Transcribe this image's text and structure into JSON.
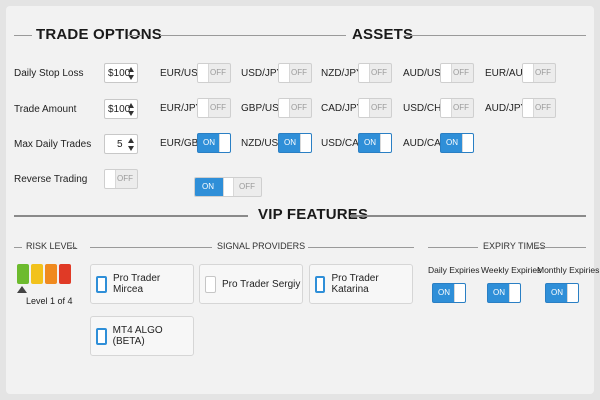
{
  "trade_options": {
    "title": "TRADE OPTIONS",
    "daily_stop_loss": {
      "label": "Daily Stop Loss",
      "value": "$100"
    },
    "trade_amount": {
      "label": "Trade Amount",
      "value": "$100"
    },
    "max_daily_trades": {
      "label": "Max Daily Trades",
      "value": "5"
    },
    "reverse_trading": {
      "label": "Reverse Trading",
      "state": "OFF"
    }
  },
  "assets": {
    "title": "ASSETS",
    "pairs": [
      {
        "label": "EUR/USD",
        "state": "OFF"
      },
      {
        "label": "USD/JPY",
        "state": "OFF"
      },
      {
        "label": "NZD/JPY",
        "state": "OFF"
      },
      {
        "label": "AUD/USD",
        "state": "OFF"
      },
      {
        "label": "EUR/AUD",
        "state": "OFF"
      },
      {
        "label": "EUR/JPY",
        "state": "OFF"
      },
      {
        "label": "GBP/USD",
        "state": "OFF"
      },
      {
        "label": "CAD/JPY",
        "state": "OFF"
      },
      {
        "label": "USD/CHF",
        "state": "OFF"
      },
      {
        "label": "AUD/JPY",
        "state": "OFF"
      },
      {
        "label": "EUR/GBP",
        "state": "ON"
      },
      {
        "label": "NZD/USD",
        "state": "ON"
      },
      {
        "label": "USD/CAD",
        "state": "ON"
      },
      {
        "label": "AUD/CAD",
        "state": "ON"
      }
    ],
    "master_toggle": {
      "on_label": "ON",
      "off_label": "OFF"
    }
  },
  "vip": {
    "title": "VIP FEATURES",
    "risk_level": {
      "title": "RISK LEVEL",
      "text": "Level 1 of 4",
      "colors": [
        "#6dbb2e",
        "#f2c21c",
        "#f08a1f",
        "#e03a26"
      ]
    },
    "signal_providers": {
      "title": "SIGNAL PROVIDERS",
      "items": [
        {
          "label": "Pro Trader Mircea",
          "checked": true
        },
        {
          "label": "Pro Trader Sergiy",
          "checked": false
        },
        {
          "label": "Pro Trader Katarina",
          "checked": true
        },
        {
          "label": "MT4 ALGO (BETA)",
          "checked": true
        }
      ]
    },
    "expiry_times": {
      "title": "EXPIRY TIMES",
      "items": [
        {
          "label": "Daily Expiries",
          "state": "ON"
        },
        {
          "label": "Weekly Expiries",
          "state": "ON"
        },
        {
          "label": "Monthly Expiries",
          "state": "ON"
        }
      ]
    }
  },
  "colors": {
    "accent": "#2f8fd8",
    "background": "#f2f2f2"
  }
}
